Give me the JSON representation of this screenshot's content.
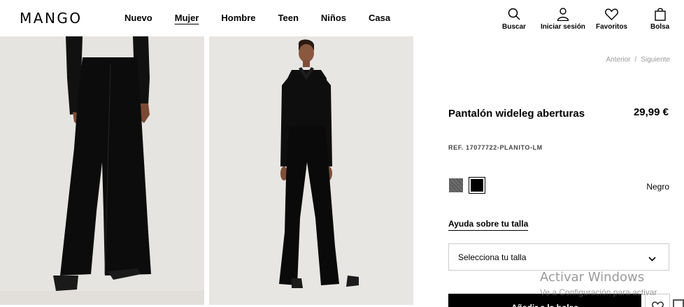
{
  "header": {
    "logo": "MANGO",
    "nav": [
      "Nuevo",
      "Mujer",
      "Hombre",
      "Teen",
      "Niños",
      "Casa"
    ],
    "active_nav": "Mujer",
    "actions": {
      "search": "Buscar",
      "login": "Iniciar sesión",
      "favorites": "Favoritos",
      "bag": "Bolsa"
    }
  },
  "product": {
    "breadcrumb_prev": "Anterior",
    "breadcrumb_sep": "/",
    "breadcrumb_next": "Siguiente",
    "name": "Pantalón wideleg aberturas",
    "price": "29,99 €",
    "ref": "REF. 17077722-PLANITO-LM",
    "color_name": "Negro",
    "colors": [
      {
        "name": "grey",
        "hex": "#5f5f5f"
      },
      {
        "name": "black",
        "hex": "#000000"
      }
    ],
    "size_help": "Ayuda sobre tu talla",
    "size_placeholder": "Selecciona tu talla",
    "add_button": "Añadir a la bolsa"
  },
  "overlay": {
    "windows_title": "Activar Windows",
    "windows_sub": "Ve a Configuración para activar"
  }
}
